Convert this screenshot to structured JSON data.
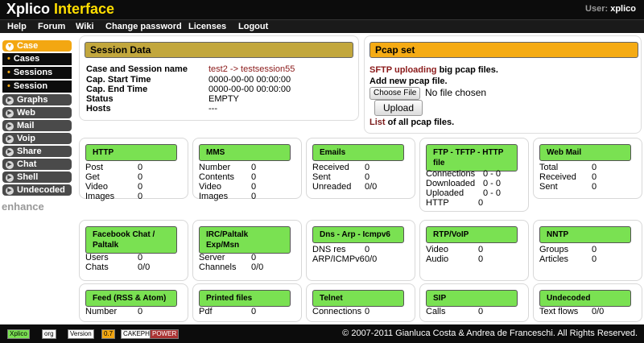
{
  "header": {
    "logo_part1": "Xplico",
    "logo_part2": "Interface",
    "user_label": "User:",
    "user_name": "xplico"
  },
  "menu": [
    "Help",
    "Forum",
    "Wiki",
    "Change password",
    "Licenses",
    "Logout"
  ],
  "sidebar": {
    "active": "Case",
    "subitems": [
      "Cases",
      "Sessions",
      "Session"
    ],
    "items": [
      "Graphs",
      "Web",
      "Mail",
      "Voip",
      "Share",
      "Chat",
      "Shell",
      "Undecoded"
    ],
    "enhance": "enhance"
  },
  "session": {
    "title": "Session Data",
    "rows": [
      {
        "label": "Case and Session name",
        "value": "test2 -> testsession55"
      },
      {
        "label": "Cap. Start Time",
        "value": "0000-00-00 00:00:00"
      },
      {
        "label": "Cap. End Time",
        "value": "0000-00-00 00:00:00"
      },
      {
        "label": "Status",
        "value": "EMPTY"
      },
      {
        "label": "Hosts",
        "value": "---"
      }
    ]
  },
  "pcap": {
    "title": "Pcap set",
    "sftp_link": "SFTP uploading",
    "sftp_rest": " big pcap files.",
    "add_new": "Add new pcap file.",
    "choose_file": "Choose File",
    "no_file": "No file chosen",
    "upload": "Upload",
    "list_link": "List",
    "list_rest": " of all pcap files."
  },
  "boxes": [
    {
      "title": "HTTP",
      "rows": [
        [
          "Post",
          "0"
        ],
        [
          "Get",
          "0"
        ],
        [
          "Video",
          "0"
        ],
        [
          "Images",
          "0"
        ]
      ]
    },
    {
      "title": "MMS",
      "rows": [
        [
          "Number",
          "0"
        ],
        [
          "Contents",
          "0"
        ],
        [
          "Video",
          "0"
        ],
        [
          "Images",
          "0"
        ]
      ]
    },
    {
      "title": "Emails",
      "rows": [
        [
          "Received",
          "0"
        ],
        [
          "Sent",
          "0"
        ],
        [
          "Unreaded",
          "0/0"
        ]
      ]
    },
    {
      "title": "FTP - TFTP - HTTP file",
      "rows": [
        [
          "Connections",
          "0 - 0"
        ],
        [
          "Downloaded",
          "0 - 0"
        ],
        [
          "Uploaded",
          "0 - 0"
        ],
        [
          "HTTP",
          "0"
        ]
      ]
    },
    {
      "title": "Web Mail",
      "rows": [
        [
          "Total",
          "0"
        ],
        [
          "Received",
          "0"
        ],
        [
          "Sent",
          "0"
        ]
      ]
    },
    {
      "title": "Facebook Chat / Paltalk",
      "rows": [
        [
          "Users",
          "0"
        ],
        [
          "Chats",
          "0/0"
        ]
      ]
    },
    {
      "title": "IRC/Paltalk Exp/Msn",
      "rows": [
        [
          "Server",
          "0"
        ],
        [
          "Channels",
          "0/0"
        ]
      ]
    },
    {
      "title": "Dns - Arp - Icmpv6",
      "rows": [
        [
          "DNS res",
          "0"
        ],
        [
          "ARP/ICMPv6",
          "0/0"
        ]
      ]
    },
    {
      "title": "RTP/VoIP",
      "rows": [
        [
          "Video",
          "0"
        ],
        [
          "Audio",
          "0"
        ]
      ]
    },
    {
      "title": "NNTP",
      "rows": [
        [
          "Groups",
          "0"
        ],
        [
          "Articles",
          "0"
        ]
      ]
    },
    {
      "title": "Feed (RSS & Atom)",
      "rows": [
        [
          "Number",
          "0"
        ]
      ]
    },
    {
      "title": "Printed files",
      "rows": [
        [
          "Pdf",
          "0"
        ]
      ]
    },
    {
      "title": "Telnet",
      "rows": [
        [
          "Connections",
          "0"
        ]
      ]
    },
    {
      "title": "SIP",
      "rows": [
        [
          "Calls",
          "0"
        ]
      ]
    },
    {
      "title": "Undecoded",
      "rows": [
        [
          "Text flows",
          "0/0"
        ]
      ]
    }
  ],
  "footer": {
    "copyright": "© 2007-2011 Gianluca Costa & Andrea de Franceschi. All Rights Reserved.",
    "badges": [
      "Xplico",
      "org",
      "Version",
      "0.7",
      "CAKEPHP",
      "POWER"
    ]
  },
  "colors": {
    "accent_orange": "#f3a712",
    "box_green": "#7ae152",
    "session_gold": "#c2a73d",
    "logo_yellow": "#ffde00"
  }
}
